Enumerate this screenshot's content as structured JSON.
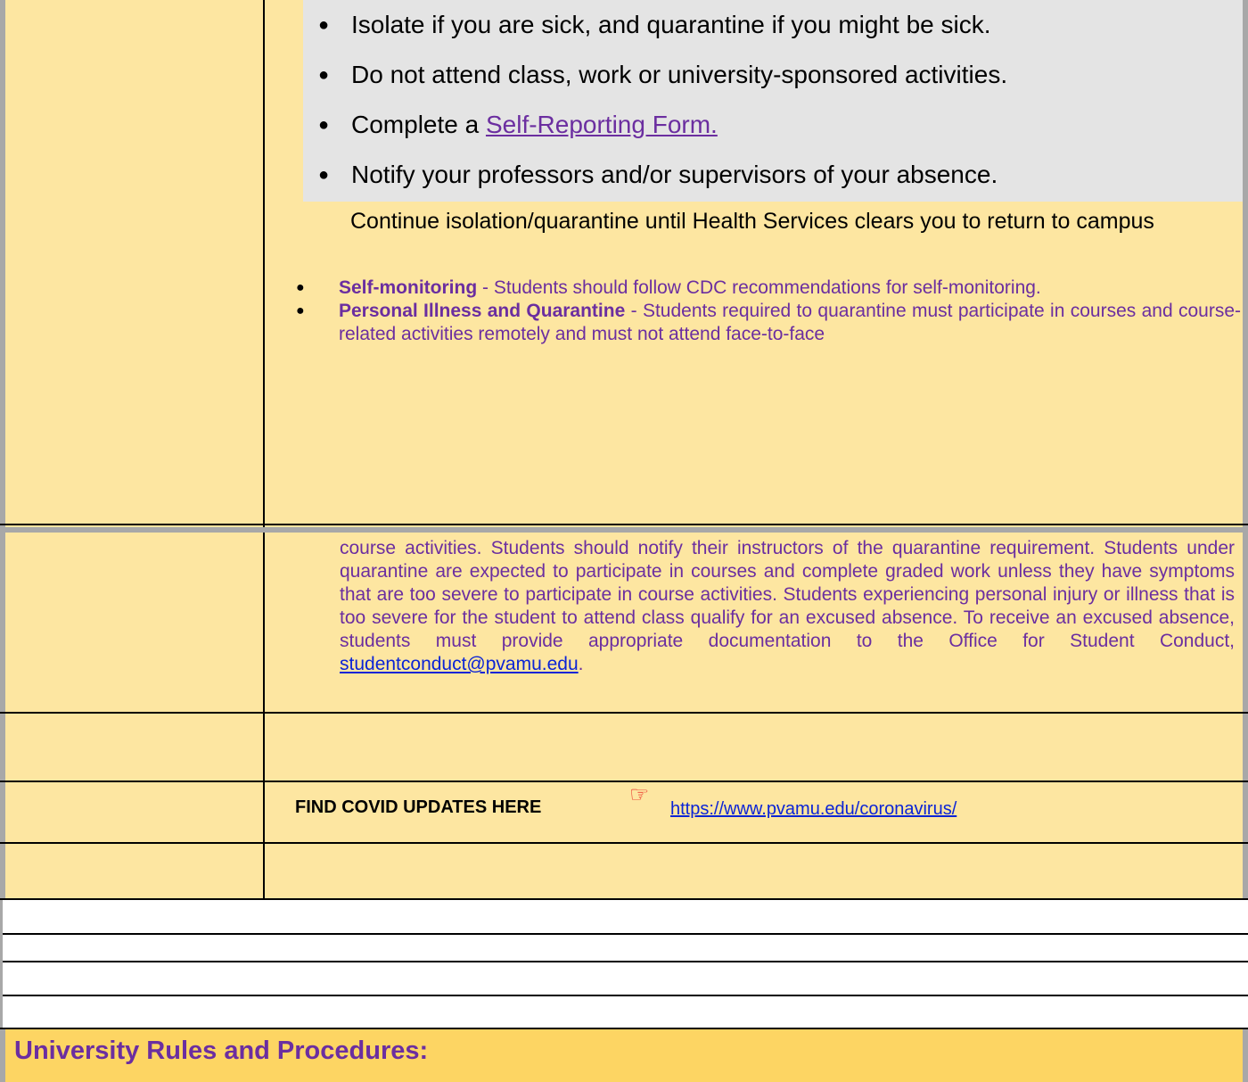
{
  "top_bullets": [
    {
      "text": "Isolate if you are sick, and quarantine if you might be sick."
    },
    {
      "text": "Do not attend class, work or university-sponsored activities."
    },
    {
      "prefix": "Complete a ",
      "link": "Self-Reporting Form."
    },
    {
      "text": "Notify your professors and/or supervisors of your absence."
    }
  ],
  "continue_text": "Continue isolation/quarantine until Health Services clears you to return to campus",
  "small_bullets": [
    {
      "title": "Self-monitoring",
      "text": " - Students should follow CDC recommendations for self-monitoring."
    },
    {
      "title": "Personal Illness and Quarantine",
      "text": " - Students required to quarantine must participate in courses and course-related activities remotely and must not attend face-to-face"
    }
  ],
  "continued_paragraph": "course activities. Students should notify their instructors of the quarantine requirement. Students under quarantine are expected to participate in courses and complete graded work unless they have symptoms that are too severe to participate in course activities. Students experiencing personal injury or illness that is too severe for the student to attend class qualify for an excused absence. To receive an excused absence, students must provide appropriate documentation to the Office for Student Conduct, ",
  "contact_email": "studentconduct@pvamu.edu",
  "contact_suffix": ".",
  "covid_label": "FIND COVID UPDATES HERE",
  "covid_icon": "pointing-hand-icon",
  "covid_url": "https://www.pvamu.edu/coronavirus/",
  "section_heading": "University Rules and Procedures:",
  "colors": {
    "cell_yellow": "#fde6a1",
    "heading_band": "#fdd563",
    "highlight_gray": "#e4e4e4",
    "text_purple": "#6b2ea0",
    "link_blue": "#0b24d6",
    "icon_red": "#e8201e"
  }
}
